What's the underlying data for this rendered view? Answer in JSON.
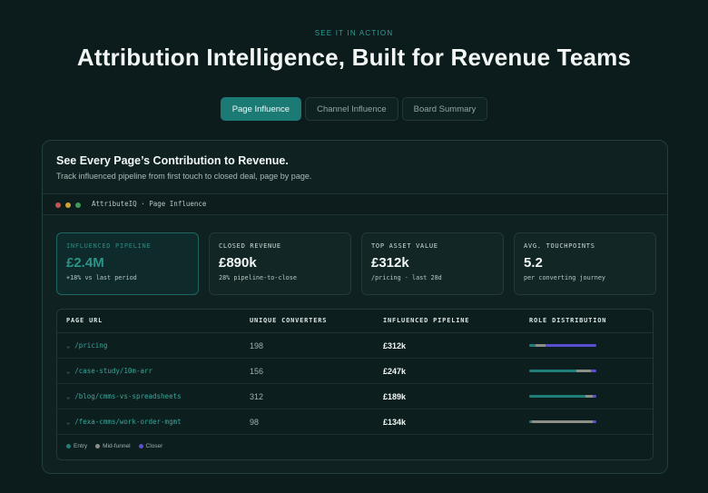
{
  "eyebrow": "SEE IT IN ACTION",
  "hero_title": "Attribution Intelligence, Built for Revenue Teams",
  "tabs": [
    {
      "label": "Page Influence",
      "active": true
    },
    {
      "label": "Channel Influence",
      "active": false
    },
    {
      "label": "Board Summary",
      "active": false
    }
  ],
  "card": {
    "title": "See Every Page’s Contribution to Revenue.",
    "subtitle": "Track influenced pipeline from first touch to closed deal, page by page."
  },
  "window": {
    "title": "AttributeIQ · Page Influence",
    "dot_colors": [
      "#c0544f",
      "#c9a23a",
      "#3e9a5a"
    ]
  },
  "kpis": [
    {
      "label": "INFLUENCED PIPELINE",
      "value": "£2.4M",
      "note": "+18% vs last period",
      "highlight": true
    },
    {
      "label": "CLOSED REVENUE",
      "value": "£890k",
      "note": "28% pipeline-to-close",
      "highlight": false
    },
    {
      "label": "TOP ASSET VALUE",
      "value": "£312k",
      "note": "/pricing · last 28d",
      "highlight": false
    },
    {
      "label": "AVG. TOUCHPOINTS",
      "value": "5.2",
      "note": "per converting journey",
      "highlight": false
    }
  ],
  "table": {
    "headers": [
      "PAGE URL",
      "UNIQUE CONVERTERS",
      "INFLUENCED PIPELINE",
      "ROLE DISTRIBUTION"
    ],
    "rows": [
      {
        "url": "/pricing",
        "converters": "198",
        "pipeline": "£312k",
        "dist": [
          0.1,
          0.15,
          0.75
        ]
      },
      {
        "url": "/case-study/10m-arr",
        "converters": "156",
        "pipeline": "£247k",
        "dist": [
          0.7,
          0.22,
          0.08
        ]
      },
      {
        "url": "/blog/cmms-vs-spreadsheets",
        "converters": "312",
        "pipeline": "£189k",
        "dist": [
          0.84,
          0.1,
          0.06
        ]
      },
      {
        "url": "/fexa-cmms/work-order-mgmt",
        "converters": "98",
        "pipeline": "£134k",
        "dist": [
          0.04,
          0.9,
          0.06
        ]
      }
    ],
    "legend": [
      {
        "label": "Entry",
        "color": "#1f7f78"
      },
      {
        "label": "Mid-funnel",
        "color": "#8d8f86"
      },
      {
        "label": "Closer",
        "color": "#5b4fd1"
      }
    ]
  },
  "colors": {
    "accent": "#1c7a75",
    "background": "#0c1c1c"
  }
}
